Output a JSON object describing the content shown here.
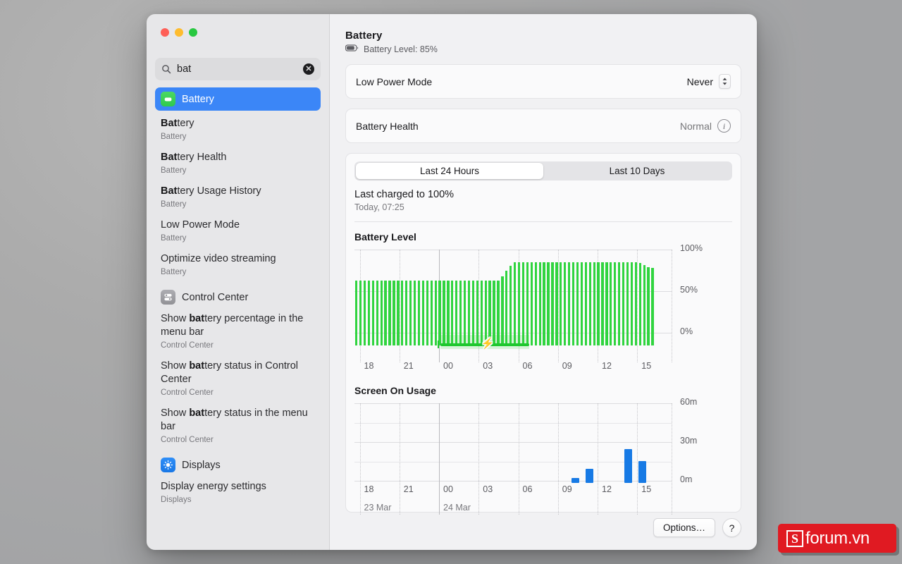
{
  "window": {
    "traffic_lights": [
      "close",
      "minimize",
      "zoom"
    ]
  },
  "sidebar": {
    "search": {
      "value": "bat",
      "placeholder": "Search",
      "icon": "search-icon",
      "clear_icon": "clear-icon"
    },
    "selected": {
      "label": "Battery",
      "icon": "battery-app-icon"
    },
    "results": [
      {
        "bold": "Bat",
        "rest": "tery",
        "sub": "Battery"
      },
      {
        "bold": "Bat",
        "rest": "tery Health",
        "sub": "Battery"
      },
      {
        "bold": "Bat",
        "rest": "tery Usage History",
        "sub": "Battery"
      },
      {
        "bold": "",
        "rest": "Low Power Mode",
        "sub": "Battery"
      },
      {
        "bold": "",
        "rest": "Optimize video streaming",
        "sub": "Battery"
      }
    ],
    "groups": [
      {
        "label": "Control Center",
        "icon": "control-center-icon",
        "results": [
          {
            "pre": "Show ",
            "bold": "bat",
            "rest": "tery percentage in the menu bar",
            "sub": "Control Center"
          },
          {
            "pre": "Show ",
            "bold": "bat",
            "rest": "tery status in Control Center",
            "sub": "Control Center"
          },
          {
            "pre": "Show ",
            "bold": "bat",
            "rest": "tery status in the menu bar",
            "sub": "Control Center"
          }
        ]
      },
      {
        "label": "Displays",
        "icon": "displays-icon",
        "results": [
          {
            "pre": "",
            "bold": "",
            "rest": "Display energy settings",
            "sub": "Displays"
          }
        ]
      }
    ]
  },
  "main": {
    "title": "Battery",
    "battery_level_line": "Battery Level: 85%",
    "battery_icon": "battery-status-icon",
    "rows": [
      {
        "key": "Low Power Mode",
        "value": "Never",
        "control": "stepper"
      },
      {
        "key": "Battery Health",
        "value": "Normal",
        "control": "info"
      }
    ],
    "tabs": [
      {
        "label": "Last 24 Hours",
        "active": true
      },
      {
        "label": "Last 10 Days",
        "active": false
      }
    ],
    "last_charged_title": "Last charged to 100%",
    "last_charged_sub": "Today, 07:25",
    "footer": {
      "options_label": "Options…",
      "help_label": "?"
    }
  },
  "watermark": {
    "mark": "S",
    "text": "forum.vn",
    "color": "#e01a22"
  },
  "chart_data": [
    {
      "id": "battery-level",
      "type": "bar",
      "title": "Battery Level",
      "xlabel": "",
      "ylabel": "",
      "ylim": [
        0,
        100
      ],
      "yticks": [
        0,
        50,
        100
      ],
      "ytick_labels": [
        "0%",
        "50%",
        "100%"
      ],
      "grid": true,
      "xtick_labels": [
        "18",
        "21",
        "00",
        "03",
        "06",
        "09",
        "12",
        "15"
      ],
      "xtick_hours": [
        18,
        21,
        0,
        3,
        6,
        9,
        12,
        15
      ],
      "bar_color": "#30d43f",
      "x_start_hour": 17.6,
      "x_end_hour": 17.6,
      "x_span_hours": 24,
      "n_bars": 72,
      "values": [
        78,
        78,
        78,
        78,
        78,
        78,
        78,
        78,
        78,
        78,
        78,
        78,
        78,
        78,
        78,
        78,
        78,
        78,
        78,
        78,
        78,
        78,
        78,
        78,
        78,
        78,
        78,
        78,
        78,
        78,
        78,
        78,
        78,
        78,
        78,
        83,
        90,
        96,
        100,
        100,
        100,
        100,
        100,
        100,
        100,
        100,
        100,
        100,
        100,
        100,
        100,
        100,
        100,
        100,
        100,
        100,
        100,
        100,
        100,
        100,
        100,
        100,
        100,
        100,
        100,
        100,
        100,
        100,
        99,
        97,
        94,
        93
      ],
      "charging": {
        "start_hour": 0.1,
        "end_hour": 6.8,
        "label": "charging",
        "icon": "bolt-icon"
      }
    },
    {
      "id": "screen-on-usage",
      "type": "bar",
      "title": "Screen On Usage",
      "xlabel": "",
      "ylabel": "",
      "ylim": [
        0,
        60
      ],
      "yticks": [
        0,
        30,
        60
      ],
      "ytick_labels": [
        "0m",
        "30m",
        "60m"
      ],
      "grid": true,
      "xtick_labels": [
        "18",
        "21",
        "00",
        "03",
        "06",
        "09",
        "12",
        "15"
      ],
      "xtick_hours": [
        18,
        21,
        0,
        3,
        6,
        9,
        12,
        15
      ],
      "date_labels": [
        {
          "label": "23 Mar",
          "hour": 18
        },
        {
          "label": "24 Mar",
          "hour": 0
        }
      ],
      "bar_color": "#177ae5",
      "x_start_hour": 17.6,
      "x_span_hours": 24,
      "bars": [
        {
          "hour": 10.0,
          "minutes": 4
        },
        {
          "hour": 11.1,
          "minutes": 11
        },
        {
          "hour": 14.0,
          "minutes": 26
        },
        {
          "hour": 15.1,
          "minutes": 17
        }
      ]
    }
  ]
}
